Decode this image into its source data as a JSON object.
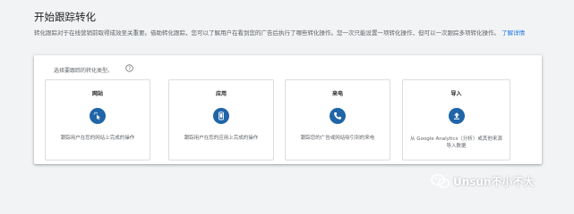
{
  "page": {
    "title": "开始跟踪转化",
    "description": "转化跟踪对于在线营销前取得成效至关重要。借助转化跟踪，您可以了解用户在看到您的广告后执行了哪些转化操作。您一次只能设置一项转化操作，但可以一次跟踪多项转化操作。",
    "learn_more": "了解详情"
  },
  "chooser": {
    "label": "选择要跟踪的转化类型。",
    "options": [
      {
        "title": "网站",
        "icon": "cursor-click-icon",
        "description": "跟踪用户在您的网站上完成的操作"
      },
      {
        "title": "应用",
        "icon": "phone-app-icon",
        "description": "跟踪用户在您的应用上完成的操作"
      },
      {
        "title": "来电",
        "icon": "phone-call-icon",
        "description": "跟踪您的广告或网站吸引到的来电"
      },
      {
        "title": "导入",
        "icon": "upload-icon",
        "description": "从 Google Analytics（分析）或其他来源导入数据"
      }
    ]
  },
  "watermark": {
    "text": "Unsun不小不大",
    "icon": "wechat-icon"
  },
  "colors": {
    "accent": "#1a73e8",
    "icon_bg": "#1f65a8",
    "background": "#f1f3f4",
    "border": "#dadce0"
  }
}
